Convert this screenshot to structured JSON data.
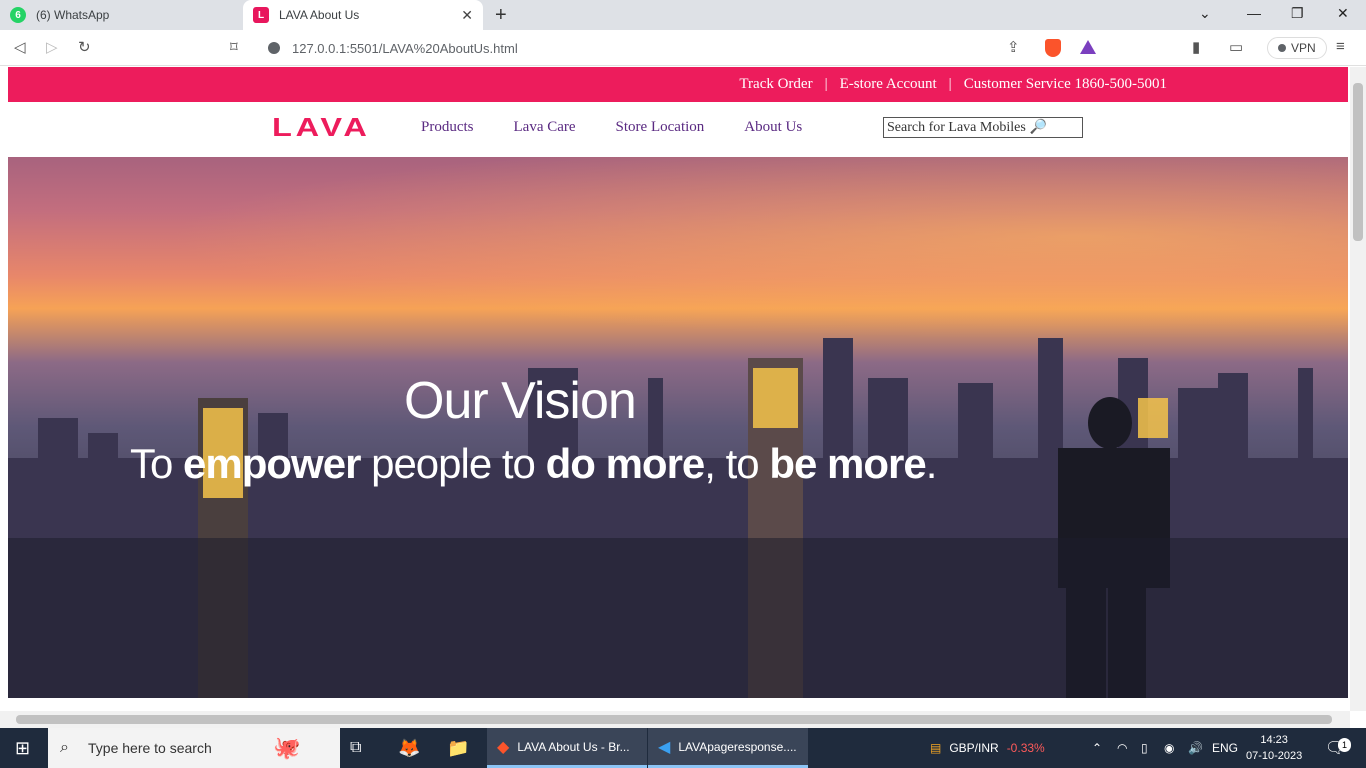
{
  "browser": {
    "tabs": [
      {
        "title": "(6) WhatsApp",
        "badge": "6",
        "active": false
      },
      {
        "title": "LAVA About Us",
        "active": true
      }
    ],
    "url": "127.0.0.1:5501/LAVA%20AboutUs.html",
    "vpn_label": "VPN"
  },
  "site": {
    "topbar": {
      "track_order": "Track Order",
      "estore": "E-store Account",
      "customer_service": "Customer Service 1860-500-5001",
      "separator": "|"
    },
    "logo": "LAVA",
    "nav": [
      "Products",
      "Lava Care",
      "Store Location",
      "About Us"
    ],
    "search_placeholder": "Search for Lava Mobiles",
    "hero": {
      "heading": "Our Vision",
      "line_parts": {
        "p1": "To ",
        "b1": "empower",
        "p2": " people to ",
        "b2": "do more",
        "p3": ", to ",
        "b3": "be more",
        "p4": "."
      }
    }
  },
  "taskbar": {
    "search_placeholder": "Type here to search",
    "apps": [
      {
        "label": "LAVA About Us - Br..."
      },
      {
        "label": "LAVApageresponse...."
      }
    ],
    "ticker": {
      "label": "GBP/INR",
      "change": "-0.33%"
    },
    "lang": "ENG",
    "time": "14:23",
    "date": "07-10-2023",
    "notification_count": "1"
  },
  "colors": {
    "brand": "#ed1c5c",
    "nav_text": "#5a2a82"
  }
}
